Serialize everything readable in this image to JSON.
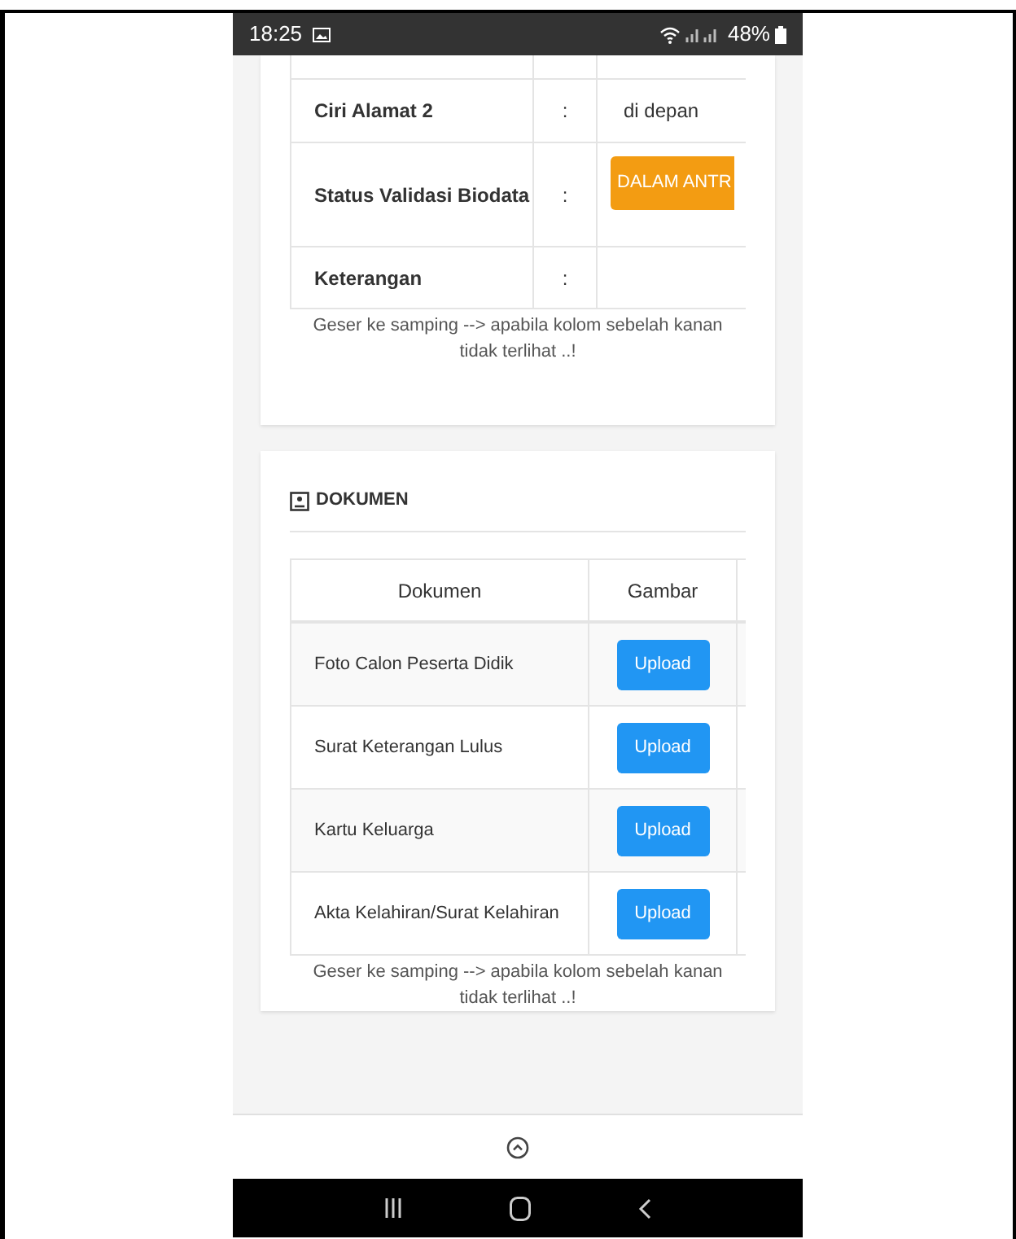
{
  "status_bar": {
    "time": "18:25",
    "battery": "48%"
  },
  "biodata_table": {
    "rows": [
      {
        "label": "Ciri Alamat 2",
        "separator": ":",
        "value": "di depan",
        "kind": "text"
      },
      {
        "label": "Status Validasi Biodata",
        "separator": ":",
        "value": "DALAM ANTR",
        "kind": "badge"
      },
      {
        "label": "Keterangan",
        "separator": ":",
        "kind": "text"
      }
    ],
    "hint": "Geser ke samping --> apabila kolom sebelah kanan tidak terlihat ..!"
  },
  "dokumen": {
    "title": "DOKUMEN",
    "columns": [
      "Dokumen",
      "Gambar"
    ],
    "rows": [
      {
        "name": "Foto Calon Peserta Didik",
        "action": "Upload"
      },
      {
        "name": "Surat Keterangan Lulus",
        "action": "Upload"
      },
      {
        "name": "Kartu Keluarga",
        "action": "Upload"
      },
      {
        "name": "Akta Kelahiran/Surat Kelahiran",
        "action": "Upload"
      }
    ],
    "hint": "Geser ke samping --> apabila kolom sebelah kanan tidak terlihat ..!"
  }
}
